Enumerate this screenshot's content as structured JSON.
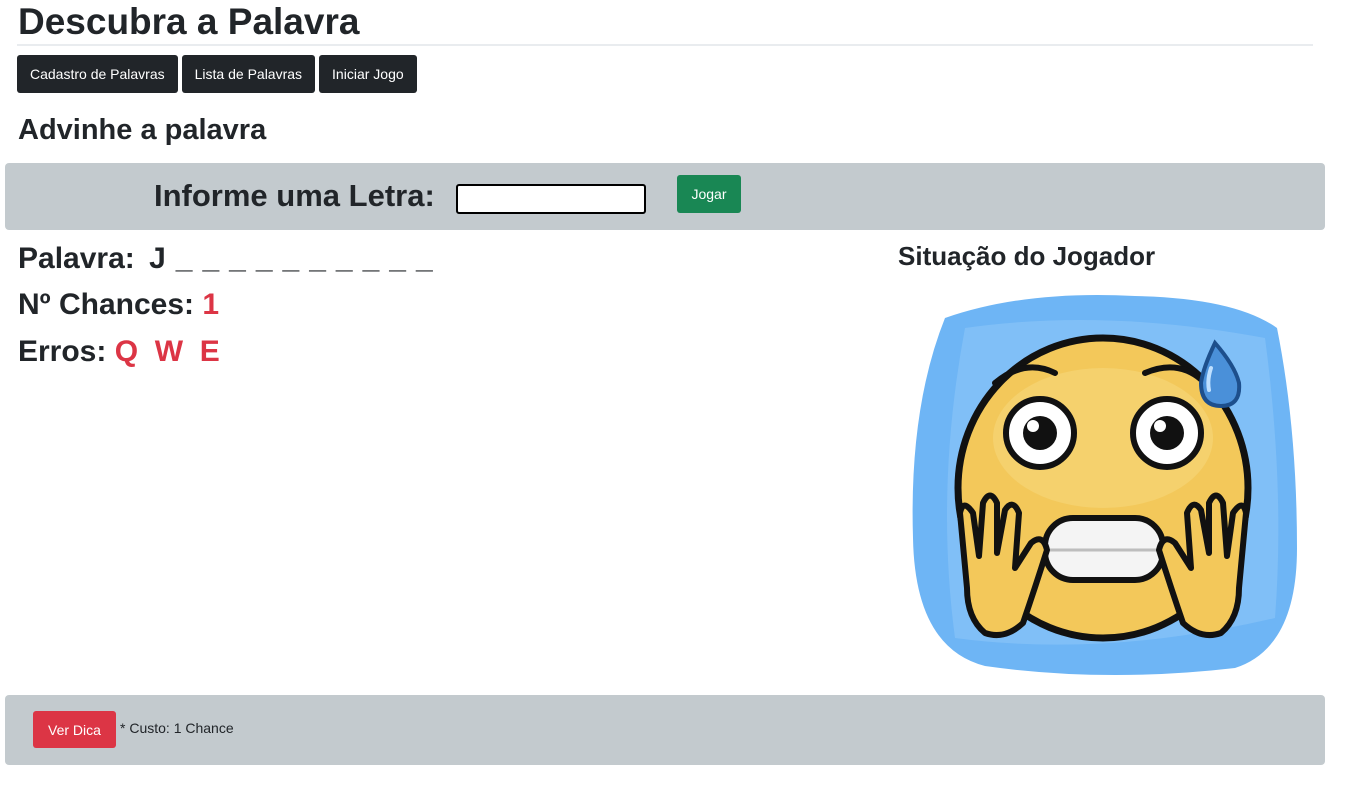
{
  "header": {
    "title": "Descubra a Palavra",
    "subtitle": "Advinhe a palavra"
  },
  "nav": {
    "items": [
      {
        "label": "Cadastro de Palavras"
      },
      {
        "label": "Lista de Palavras"
      },
      {
        "label": "Iniciar Jogo"
      }
    ]
  },
  "guess_form": {
    "label": "Informe uma Letra:",
    "input_value": "",
    "button_label": "Jogar"
  },
  "game": {
    "word_label": "Palavra:",
    "word_letters": [
      "J",
      "_",
      "_",
      "_",
      "_",
      "_",
      "_",
      "_",
      "_",
      "_",
      "_"
    ],
    "chances_label": "Nº Chances:",
    "chances_value": "1",
    "errors_label": "Erros:",
    "errors": [
      "Q",
      "W",
      "E"
    ]
  },
  "player_status": {
    "title": "Situação do Jogador",
    "image_icon": "anxious-emoji"
  },
  "hint": {
    "button_label": "Ver Dica",
    "cost_text": "* Custo: 1 Chance"
  },
  "colors": {
    "nav_button": "#212529",
    "play_button": "#198754",
    "hint_button": "#dc3545",
    "error_text": "#dc3545",
    "panel_background": "#c3cace"
  }
}
